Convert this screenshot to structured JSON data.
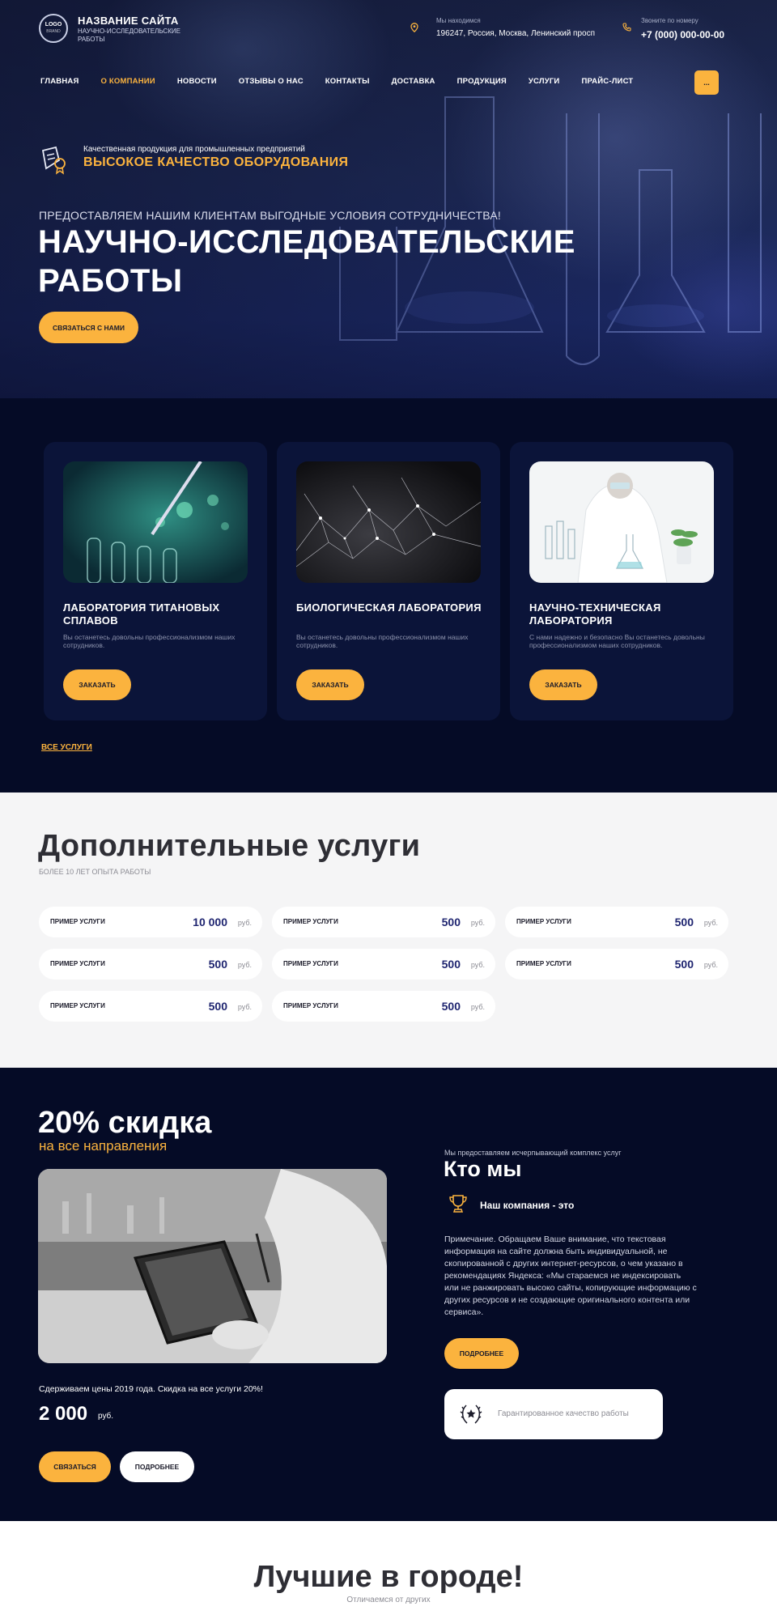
{
  "header": {
    "logo_text": "LOGO",
    "logo_sub": "BRAND",
    "site_title": "НАЗВАНИЕ САЙТА",
    "site_subtitle": "НАУЧНО-ИССЛЕДОВАТЕЛЬСКИЕ РАБОТЫ",
    "address_caption": "Мы находимся",
    "address": "196247, Россия, Москва, Ленинский просп",
    "phone_caption": "Звоните по номеру",
    "phone": "+7 (000) 000-00-00",
    "menu_button": "..."
  },
  "nav": [
    "ГЛАВНАЯ",
    "О КОМПАНИИ",
    "НОВОСТИ",
    "ОТЗЫВЫ О НАС",
    "КОНТАКТЫ",
    "ДОСТАВКА",
    "ПРОДУКЦИЯ",
    "УСЛУГИ",
    "ПРАЙС-ЛИСТ"
  ],
  "nav_active": "О КОМПАНИИ",
  "hero": {
    "badge_small": "Качественная продукция для промышленных предприятий",
    "badge_big": "ВЫСОКОЕ КАЧЕСТВО ОБОРУДОВАНИЯ",
    "kicker": "ПРЕДОСТАВЛЯЕМ НАШИМ КЛИЕНТАМ ВЫГОДНЫЕ УСЛОВИЯ СОТРУДНИЧЕСТВА!",
    "title": "НАУЧНО-ИССЛЕДОВАТЕЛЬСКИЕ РАБОТЫ",
    "button": "СВЯЗАТЬСЯ С НАМИ"
  },
  "labs": {
    "cards": [
      {
        "title": "ЛАБОРАТОРИЯ ТИТАНОВЫХ СПЛАВОВ",
        "desc": "Вы останетесь довольны профессионализмом наших сотрудников.",
        "button": "ЗАКАЗАТЬ"
      },
      {
        "title": "БИОЛОГИЧЕСКАЯ ЛАБОРАТОРИЯ",
        "desc": "Вы останетесь довольны профессионализмом наших сотрудников.",
        "button": "ЗАКАЗАТЬ"
      },
      {
        "title": "НАУЧНО-ТЕХНИЧЕСКАЯ ЛАБОРАТОРИЯ",
        "desc": "С нами надежно и безопасно Вы останетесь довольны профессионализмом наших сотрудников.",
        "button": "ЗАКАЗАТЬ"
      }
    ],
    "all_link": "ВСЕ УСЛУГИ"
  },
  "extra": {
    "title": "Дополнительные услуги",
    "subtitle": "БОЛЕЕ 10 ЛЕТ ОПЫТА РАБОТЫ",
    "currency": "руб.",
    "items": [
      {
        "name": "ПРИМЕР УСЛУГИ",
        "price": "10 000"
      },
      {
        "name": "ПРИМЕР УСЛУГИ",
        "price": "500"
      },
      {
        "name": "ПРИМЕР УСЛУГИ",
        "price": "500"
      },
      {
        "name": "ПРИМЕР УСЛУГИ",
        "price": "500"
      },
      {
        "name": "ПРИМЕР УСЛУГИ",
        "price": "500"
      },
      {
        "name": "ПРИМЕР УСЛУГИ",
        "price": "500"
      },
      {
        "name": "ПРИМЕР УСЛУГИ",
        "price": "500"
      },
      {
        "name": "ПРИМЕР УСЛУГИ",
        "price": "500"
      }
    ]
  },
  "promo": {
    "title": "20% скидка",
    "subtitle": "на все направления",
    "note": "Сдерживаем цены 2019 года. Скидка на все услуги 20%!",
    "price": "2 000",
    "currency": "руб.",
    "button_contact": "СВЯЗАТЬСЯ",
    "button_more": "ПОДРОБНЕЕ"
  },
  "about": {
    "caption": "Мы предоставляем исчерпывающий комплекс услуг",
    "title": "Кто мы",
    "company": "Наш компания - это",
    "text": "Примечание. Обращаем Ваше внимание, что текстовая информация на сайте должна быть индивидуальной, не скопированной с других интернет-ресурсов, о чем указано в рекомендациях Яндекса: «Мы стараемся не индексировать или не ранжировать высоко сайты, копирующие информацию с других ресурсов и не создающие оригинального контента или сервиса».",
    "button": "ПОДРОБНЕЕ",
    "guarantee": "Гарантированное качество работы"
  },
  "best": {
    "title": "Лучшие в городе!",
    "subtitle": "Отличаемся от других"
  },
  "colors": {
    "accent": "#fbb33e",
    "dark": "#050b26",
    "card": "#0b1439",
    "price": "#1f2570"
  }
}
